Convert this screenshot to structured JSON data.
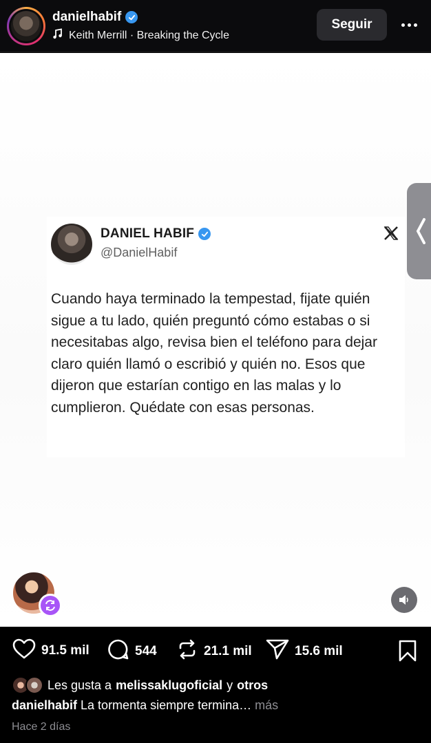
{
  "header": {
    "username": "danielhabif",
    "music": "Keith Merrill · Breaking the Cycle",
    "follow_label": "Seguir"
  },
  "tweet": {
    "name": "DANIEL HABIF",
    "handle": "@DanielHabif",
    "text": "Cuando haya terminado la tempestad, fijate quién sigue a tu lado, quién preguntó cómo estabas o si necesitabas algo, revisa bien el teléfono para dejar claro quién llamó o escribió y quién no. Esos que dijeron que estarían contigo en las malas y lo cumplieron. Quédate con esas personas."
  },
  "actions": {
    "likes": "91.5 mil",
    "comments": "544",
    "reposts": "21.1 mil",
    "shares": "15.6 mil"
  },
  "footer": {
    "liked_prefix": "Les gusta a",
    "liked_user": "melissaklugoficial",
    "liked_joiner": "y",
    "liked_others": "otros",
    "caption_user": "danielhabif",
    "caption_text": "La tormenta siempre termina…",
    "caption_more": "más",
    "timestamp": "Hace 2 días"
  },
  "colors": {
    "verified": "#3897f0",
    "repost_badge": "#a855f7",
    "follow_bg": "#2a2a2e",
    "muted": "#8e8e93"
  },
  "icons": [
    "music-note-icon",
    "verified-icon",
    "more-icon",
    "x-logo-icon",
    "chevron-left-icon",
    "sound-icon",
    "repost-icon",
    "heart-icon",
    "comment-icon",
    "share-icon",
    "bookmark-icon"
  ]
}
